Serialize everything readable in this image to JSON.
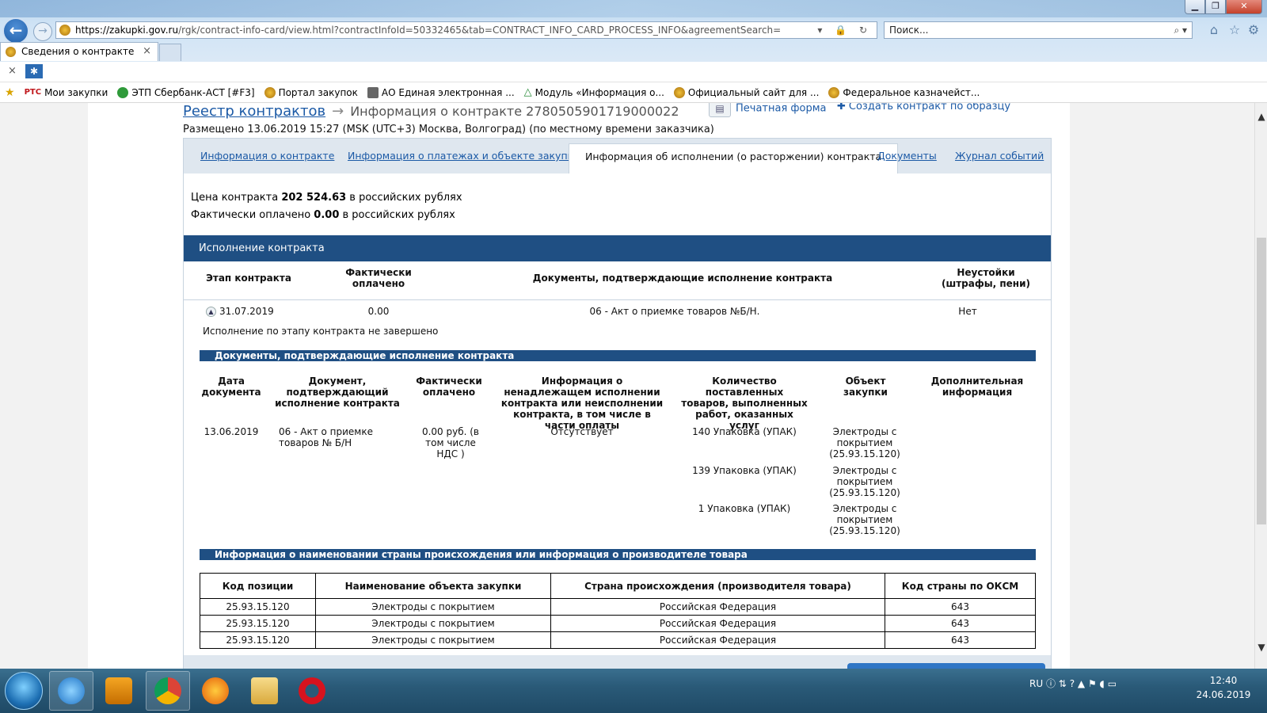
{
  "browser": {
    "url_host": "https://zakupki.gov.ru",
    "url_path": "/rgk/contract-info-card/view.html?contractInfoId=50332465&tab=CONTRACT_INFO_CARD_PROCESS_INFO&agreementSearch=",
    "search_placeholder": "Поиск...",
    "tab_title": "Сведения о контракте",
    "close_glyph": "×",
    "window_controls": {
      "minimize": "▁",
      "maximize": "❐",
      "close": "✕"
    }
  },
  "favorites": [
    {
      "label": "Мои закупки",
      "prefix": "РТС"
    },
    {
      "label": "ЭТП Сбербанк-АСТ [#F3]"
    },
    {
      "label": "Портал закупок"
    },
    {
      "label": "АО Единая электронная ..."
    },
    {
      "label": "Модуль «Информация о..."
    },
    {
      "label": "Официальный сайт для ..."
    },
    {
      "label": "Федеральное казначейст..."
    }
  ],
  "page": {
    "breadcrumb_root": "Реестр контрактов",
    "breadcrumb_current": "Информация о контракте 2780505901719000022",
    "print_label": "Печатная форма",
    "create_label": "Создать контракт по образцу",
    "placed_text": "Размещено 13.06.2019 15:27 (MSK (UTC+3) Москва, Волгоград) (по местному времени заказчика)",
    "tabs": [
      {
        "label": "Информация о контракте"
      },
      {
        "label": "Информация о платежах и объекте закупки"
      },
      {
        "label": "Информация об исполнении (о расторжении) контракта"
      },
      {
        "label": "Документы"
      },
      {
        "label": "Журнал событий"
      }
    ],
    "price_label": "Цена контракта",
    "price_value": "202 524.63",
    "price_currency": "в российских рублях",
    "paid_label": "Фактически оплачено",
    "paid_value": "0.00",
    "paid_currency": "в российских рублях",
    "execution_header": "Исполнение контракта",
    "exec_columns": {
      "stage": "Этап контракта",
      "paid": "Фактически оплачено",
      "docs": "Документы, подтверждающие исполнение контракта",
      "penalties": "Неустойки (штрафы, пени)"
    },
    "exec_row": {
      "date": "31.07.2019",
      "paid": "0.00",
      "doc": "06 - Акт о приемке товаров №Б/Н.",
      "penalties": "Нет"
    },
    "stage_status": "Исполнение по этапу контракта не завершено",
    "docs_header": "Документы, подтверждающие исполнение контракта",
    "docs_columns": {
      "date": "Дата документа",
      "doc": "Документ, подтверждающий исполнение контракта",
      "paid": "Фактически оплачено",
      "info": "Информация о ненадлежащем исполнении контракта или неисполнении контракта, в том числе в части оплаты",
      "qty": "Количество поставленных товаров, выполненных работ, оказанных услуг",
      "object": "Объект закупки",
      "extra": "Дополнительная информация"
    },
    "docs_row": {
      "date": "13.06.2019",
      "doc": "06 - Акт о приемке товаров № Б/Н",
      "paid": "0.00 руб. (в том числе НДС )",
      "info": "Отсутствует"
    },
    "docs_items": [
      {
        "qty": "140 Упаковка (УПАК)",
        "object": "Электроды с покрытием (25.93.15.120)"
      },
      {
        "qty": "139 Упаковка (УПАК)",
        "object": "Электроды с покрытием (25.93.15.120)"
      },
      {
        "qty": "1 Упаковка (УПАК)",
        "object": "Электроды с покрытием (25.93.15.120)"
      }
    ],
    "origin_header": "Информация о наименовании страны происхождения или информация о производителе товара",
    "origin_columns": [
      "Код позиции",
      "Наименование объекта закупки",
      "Страна происхождения (производителя товара)",
      "Код страны по ОКСМ"
    ],
    "origin_rows": [
      [
        "25.93.15.120",
        "Электроды с покрытием",
        "Российская Федерация",
        "643"
      ],
      [
        "25.93.15.120",
        "Электроды с покрытием",
        "Российская Федерация",
        "643"
      ],
      [
        "25.93.15.120",
        "Электроды с покрытием",
        "Российская Федерация",
        "643"
      ]
    ]
  },
  "taskbar": {
    "lang": "RU",
    "time": "12:40",
    "date": "24.06.2019"
  },
  "colors": {
    "header_blue": "#1f4f83",
    "link_blue": "#1c5aa6",
    "tab_strip": "#dfe7ef"
  }
}
